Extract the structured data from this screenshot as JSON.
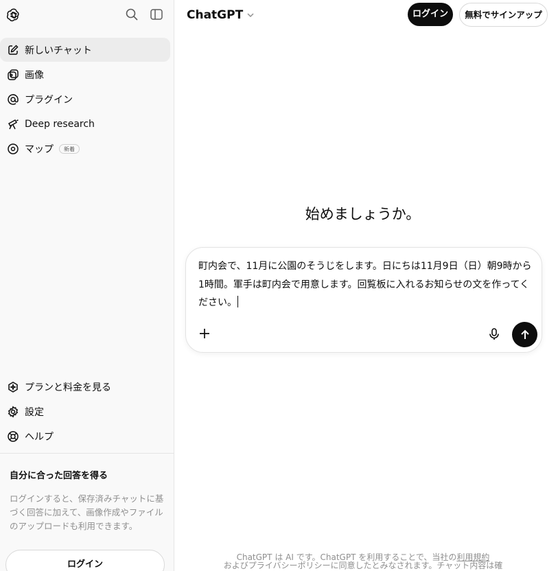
{
  "sidebar": {
    "nav": [
      {
        "label": "新しいチャット",
        "icon": "new-chat-icon",
        "active": true
      },
      {
        "label": "画像",
        "icon": "image-icon"
      },
      {
        "label": "プラグイン",
        "icon": "plugin-icon"
      },
      {
        "label": "Deep research",
        "icon": "telescope-icon"
      },
      {
        "label": "マップ",
        "icon": "map-pin-icon",
        "badge": "新着"
      }
    ],
    "bottom": [
      {
        "label": "プランと料金を見る",
        "icon": "upgrade-icon"
      },
      {
        "label": "設定",
        "icon": "gear-icon"
      },
      {
        "label": "ヘルプ",
        "icon": "help-icon"
      }
    ],
    "promo": {
      "title": "自分に合った回答を得る",
      "text": "ログインすると、保存済みチャットに基づく回答に加えて、画像作成やファイルのアップロードも利用できます。"
    },
    "login_label": "ログイン"
  },
  "header": {
    "model": "ChatGPT",
    "login_label": "ログイン",
    "signup_label": "無料でサインアップ"
  },
  "main": {
    "heading": "始めましょうか。",
    "composer_text": "町内会で、11月に公園のそうじをします。日にちは11月9日（日）朝9時から1時間。軍手は町内会で用意します。回覧板に入れるお知らせの文を作ってください。"
  },
  "footer": {
    "line1_prefix": "ChatGPT は AI です。ChatGPT を利用することで、当社の",
    "line1_link": "利用規約",
    "line2": "およびプライバシーポリシーに同意したとみなされます。チャット内容は確"
  },
  "colors": {
    "sidebar_bg": "#f9f9f9",
    "active_item": "#ececec",
    "primary_button": "#0d0d0d",
    "muted_text": "#8f8f8f"
  }
}
